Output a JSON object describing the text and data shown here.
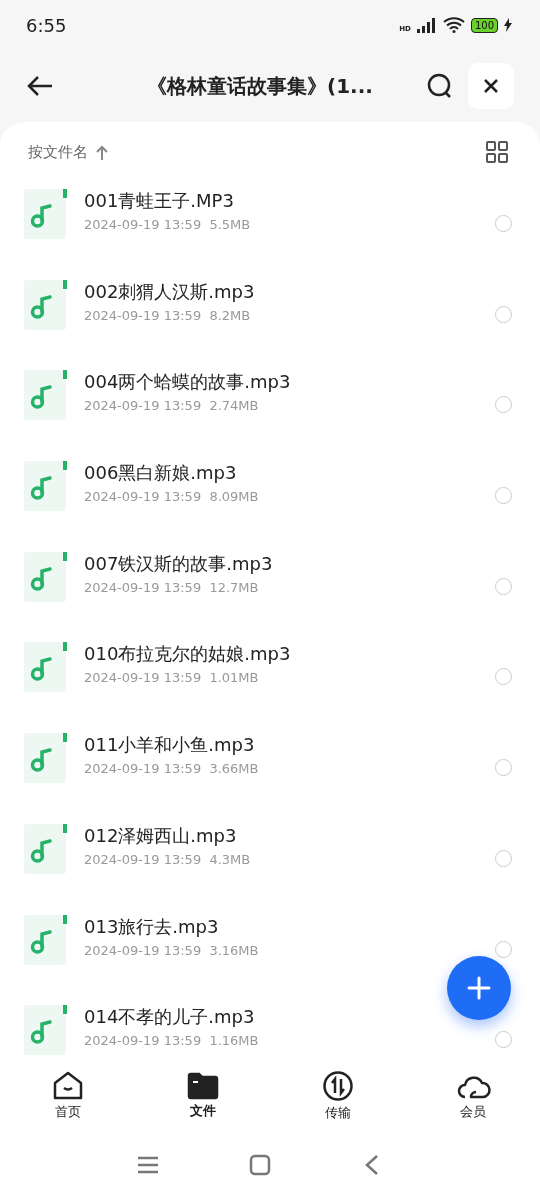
{
  "status_bar": {
    "time": "6:55",
    "network": "HD",
    "battery": "100"
  },
  "header": {
    "title": "《格林童话故事集》(1..."
  },
  "sort": {
    "label": "按文件名"
  },
  "files": [
    {
      "name": "001青蛙王子.MP3",
      "date": "2024-09-19 13:59",
      "size": "5.5MB",
      "checked": false
    },
    {
      "name": "002刺猬人汉斯.mp3",
      "date": "2024-09-19 13:59",
      "size": "8.2MB",
      "checked": false
    },
    {
      "name": "004两个蛤蟆的故事.mp3",
      "date": "2024-09-19 13:59",
      "size": "2.74MB",
      "checked": false
    },
    {
      "name": "006黑白新娘.mp3",
      "date": "2024-09-19 13:59",
      "size": "8.09MB",
      "checked": false
    },
    {
      "name": "007铁汉斯的故事.mp3",
      "date": "2024-09-19 13:59",
      "size": "12.7MB",
      "checked": false
    },
    {
      "name": "010布拉克尔的姑娘.mp3",
      "date": "2024-09-19 13:59",
      "size": "1.01MB",
      "checked": false
    },
    {
      "name": "011小羊和小鱼.mp3",
      "date": "2024-09-19 13:59",
      "size": "3.66MB",
      "checked": false
    },
    {
      "name": "012泽姆西山.mp3",
      "date": "2024-09-19 13:59",
      "size": "4.3MB",
      "checked": false
    },
    {
      "name": "013旅行去.mp3",
      "date": "2024-09-19 13:59",
      "size": "3.16MB",
      "checked": false
    },
    {
      "name": "014不孝的儿子.mp3",
      "date": "2024-09-19 13:59",
      "size": "1.16MB",
      "checked": false
    }
  ],
  "tabs": [
    {
      "label": "首页",
      "kind": "home",
      "selected": false
    },
    {
      "label": "文件",
      "kind": "files",
      "selected": true
    },
    {
      "label": "传输",
      "kind": "transfer",
      "selected": false
    },
    {
      "label": "会员",
      "kind": "member",
      "selected": false
    }
  ]
}
